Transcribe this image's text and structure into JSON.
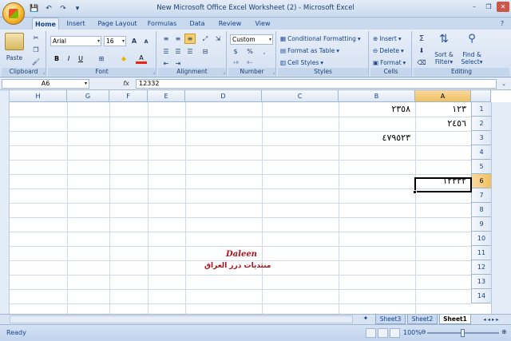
{
  "window": {
    "title": "New Microsoft Office Excel Worksheet (2) - Microsoft Excel",
    "minimize": "–",
    "restore": "❐",
    "close": "✕"
  },
  "qat": {
    "save": "💾",
    "undo": "↶",
    "redo": "↷",
    "more": "▾"
  },
  "tabs": [
    "Home",
    "Insert",
    "Page Layout",
    "Formulas",
    "Data",
    "Review",
    "View"
  ],
  "tab_help": "?",
  "ribbon": {
    "clipboard": {
      "paste": "Paste",
      "label": "Clipboard"
    },
    "font": {
      "name": "Arial",
      "size": "16",
      "label": "Font",
      "bold": "B",
      "italic": "I",
      "underline": "U",
      "grow": "A",
      "shrink": "A",
      "font_color": "A"
    },
    "alignment": {
      "label": "Alignment"
    },
    "number": {
      "format": "Custom",
      "percent": "%",
      "comma": ",",
      "label": "Number"
    },
    "styles": {
      "conditional": "Conditional Formatting",
      "format_table": "Format as Table",
      "cell_styles": "Cell Styles",
      "label": "Styles"
    },
    "cells": {
      "insert": "Insert",
      "delete": "Delete",
      "format": "Format",
      "label": "Cells"
    },
    "editing": {
      "sum": "Σ",
      "sort": "Sort &",
      "filter": "Filter",
      "find": "Find &",
      "select": "Select",
      "label": "Editing"
    }
  },
  "formula_bar": {
    "name_box": "A6",
    "fx": "fx",
    "value": "12332"
  },
  "columns": [
    "H",
    "G",
    "F",
    "E",
    "D",
    "C",
    "B",
    "A"
  ],
  "rows": [
    "1",
    "2",
    "3",
    "4",
    "5",
    "6",
    "7",
    "8",
    "9",
    "10",
    "11",
    "12",
    "13",
    "14"
  ],
  "cells": {
    "A1": "١٢٣",
    "B1": "٢٣٥٨",
    "A2": "٢٤٥٦",
    "B3": "٤٧٩٥٢٣",
    "A6": "١٢٣٣٢"
  },
  "watermark": {
    "line1": "Daleen",
    "line2": "منتديات درر العراق"
  },
  "sheets": [
    "Sheet3",
    "Sheet2",
    "Sheet1"
  ],
  "sheet_nav": "◂ ◂ ▸ ▸",
  "status": {
    "ready": "Ready",
    "zoom": "100%",
    "zoom_out": "⊖",
    "zoom_in": "⊕"
  },
  "colors": {
    "accent": "#15428b",
    "selected_header": "#f1c15f",
    "watermark": "#b0101a"
  }
}
